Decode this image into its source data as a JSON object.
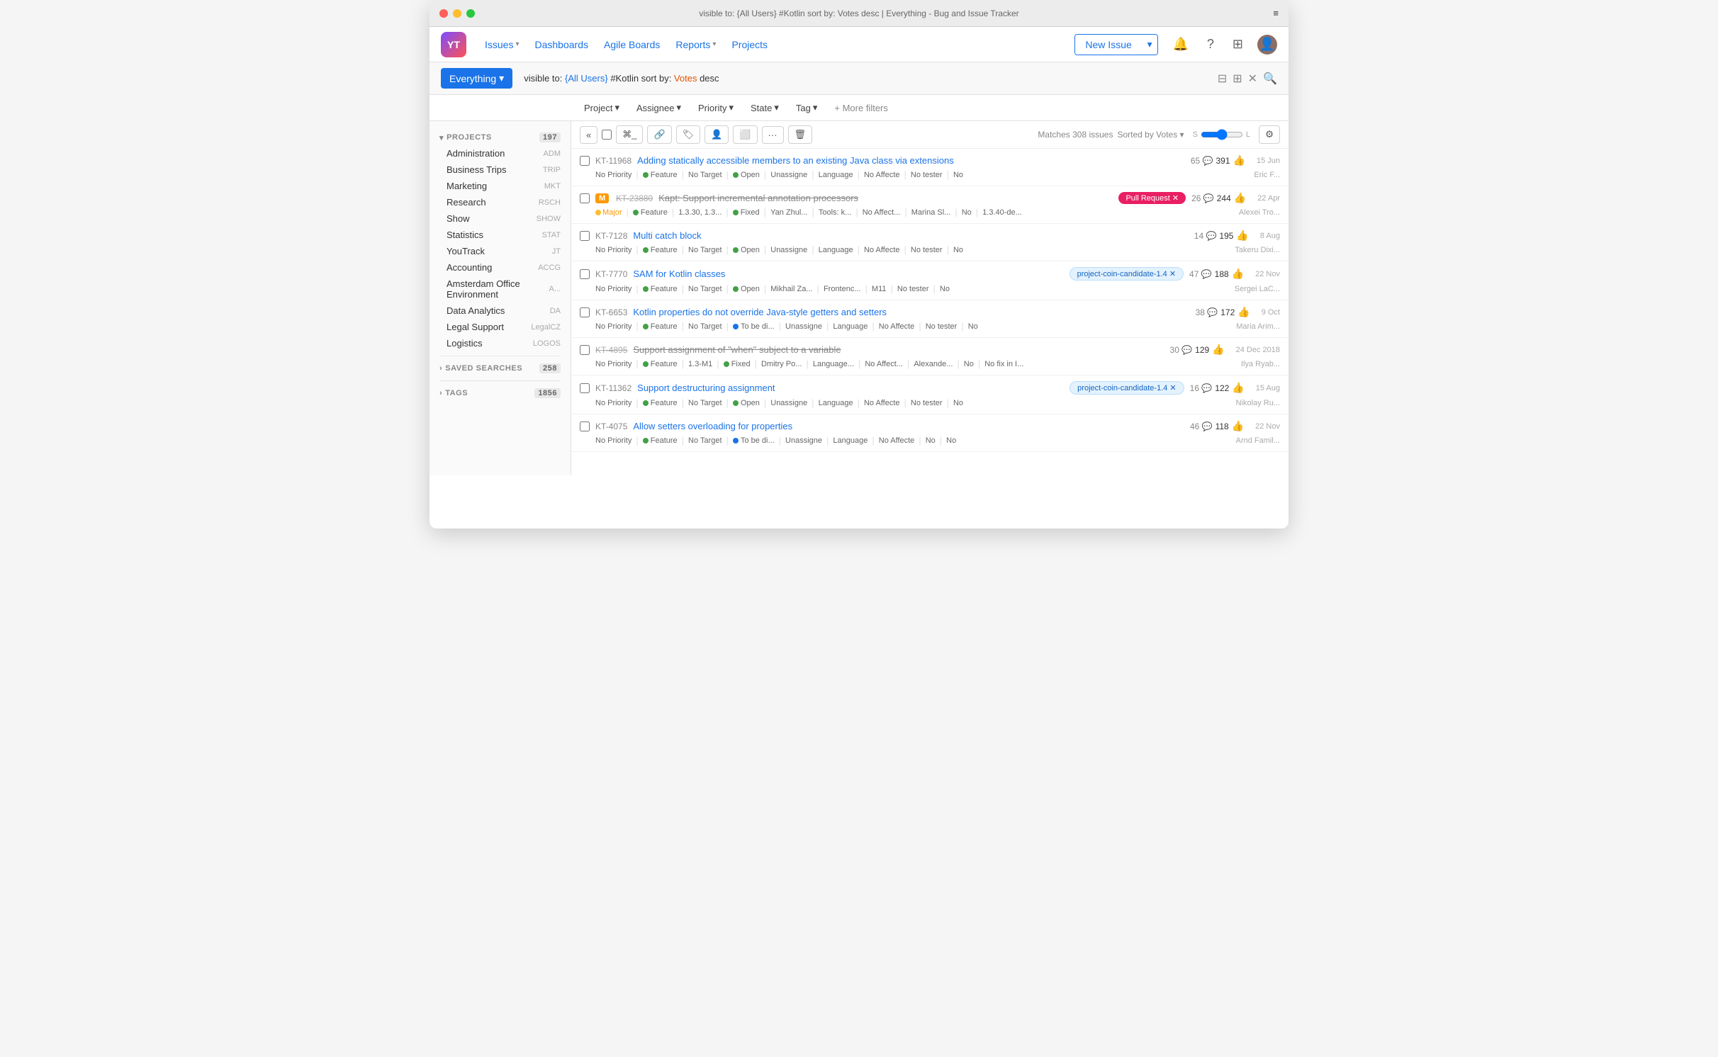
{
  "window": {
    "title": "visible to: {All Users} #Kotlin sort by: Votes desc | Everything - Bug and Issue Tracker",
    "traffic_lights": [
      "red",
      "yellow",
      "green"
    ]
  },
  "navbar": {
    "logo": "YT",
    "items": [
      {
        "label": "Issues",
        "has_arrow": true
      },
      {
        "label": "Dashboards",
        "has_arrow": false
      },
      {
        "label": "Agile Boards",
        "has_arrow": false
      },
      {
        "label": "Reports",
        "has_arrow": true
      },
      {
        "label": "Projects",
        "has_arrow": false
      }
    ],
    "new_issue": "New Issue",
    "new_issue_arrow": "▼"
  },
  "searchbar": {
    "everything_label": "Everything",
    "everything_arrow": "▾",
    "query_prefix": "visible to: ",
    "query_hl1": "{All Users}",
    "query_mid": " #Kotlin sort by: ",
    "query_hl2": "Votes",
    "query_suffix": " desc"
  },
  "filters": {
    "project": "Project",
    "assignee": "Assignee",
    "priority": "Priority",
    "state": "State",
    "tag": "Tag",
    "more": "+ More filters"
  },
  "sidebar": {
    "projects_label": "PROJECTS",
    "projects_count": "197",
    "projects": [
      {
        "name": "Administration",
        "tag": "ADM"
      },
      {
        "name": "Business Trips",
        "tag": "TRIP"
      },
      {
        "name": "Marketing",
        "tag": "MKT"
      },
      {
        "name": "Research",
        "tag": "RSCH"
      },
      {
        "name": "Show",
        "tag": "SHOW"
      },
      {
        "name": "Statistics",
        "tag": "STAT"
      },
      {
        "name": "YouTrack",
        "tag": "JT"
      },
      {
        "name": "Accounting",
        "tag": "ACCG"
      },
      {
        "name": "Amsterdam Office Environment",
        "tag": "A..."
      },
      {
        "name": "Data Analytics",
        "tag": "DA"
      },
      {
        "name": "Legal Support",
        "tag": "LegalCZ"
      },
      {
        "name": "Logistics",
        "tag": "LOGOS"
      }
    ],
    "saved_searches_label": "SAVED SEARCHES",
    "saved_searches_count": "258",
    "tags_label": "TAGS",
    "tags_count": "1856"
  },
  "issues_toolbar": {
    "match_info": "Matches 308 issues",
    "sorted_by": "Sorted by Votes",
    "size_s": "S",
    "size_l": "L",
    "toolbar_icons": [
      "⌘_",
      "🔗",
      "🏷",
      "👤",
      "⬜",
      "···",
      "🗑"
    ]
  },
  "issues": [
    {
      "id": "KT-11968",
      "strikethrough": false,
      "title": "Adding statically accessible members to an existing Java class via extensions",
      "badge": null,
      "comments": "65",
      "votes": "391",
      "priority": "No Priority",
      "type": "Feature",
      "target": "No Target",
      "state": "Open",
      "state_color": "green",
      "assignee": "Unassigne",
      "subsystem": "Language",
      "affected": "No Affecte",
      "tester": "No tester",
      "fix": "No",
      "author": "Eric F...",
      "date": "15 Jun"
    },
    {
      "id": "KT-23880",
      "strikethrough": true,
      "title": "Kapt: Support incremental annotation processors",
      "badge": "Pull Request ✕",
      "badge_type": "pull-request",
      "m_badge": "M",
      "comments": "26",
      "votes": "244",
      "priority": "Major",
      "priority_color": "yellow",
      "type": "Feature",
      "target": "1.3.30, 1.3...",
      "state": "Fixed",
      "state_color": "green",
      "assignee": "Yan Zhul...",
      "subsystem": "Tools: k...",
      "affected": "No Affect...",
      "tester": "Marina Sl...",
      "fix": "No",
      "version": "1.3.40-de...",
      "author": "Alexei Tro...",
      "date": "22 Apr"
    },
    {
      "id": "KT-7128",
      "strikethrough": false,
      "title": "Multi catch block",
      "badge": null,
      "comments": "14",
      "votes": "195",
      "priority": "No Priority",
      "type": "Feature",
      "target": "No Target",
      "state": "Open",
      "state_color": "green",
      "assignee": "Unassigne",
      "subsystem": "Language",
      "affected": "No Affecte",
      "tester": "No tester",
      "fix": "No",
      "author": "Takeru Dixi...",
      "date": "8 Aug"
    },
    {
      "id": "KT-7770",
      "strikethrough": false,
      "title": "SAM for Kotlin classes",
      "badge": "project-coin-candidate-1.4 ✕",
      "badge_type": "tag",
      "comments": "47",
      "votes": "188",
      "priority": "No Priority",
      "type": "Feature",
      "target": "No Target",
      "state": "Open",
      "state_color": "green",
      "assignee": "Mikhail Za...",
      "subsystem": "Frontenc...",
      "affected": "M11",
      "tester": "No tester",
      "fix": "No",
      "author": "Sergei LaC...",
      "date": "22 Nov"
    },
    {
      "id": "KT-6653",
      "strikethrough": false,
      "title": "Kotlin properties do not override Java-style getters and setters",
      "badge": null,
      "comments": "38",
      "votes": "172",
      "priority": "No Priority",
      "type": "Feature",
      "target": "No Target",
      "state": "To be di...",
      "state_color": "blue",
      "assignee": "Unassigne",
      "subsystem": "Language",
      "affected": "No Affecte",
      "tester": "No tester",
      "fix": "No",
      "author": "Maria Arim...",
      "date": "9 Oct"
    },
    {
      "id": "KT-4895",
      "strikethrough": true,
      "title": "Support assignment of \"when\" subject to a variable",
      "badge": null,
      "comments": "30",
      "votes": "129",
      "priority": "No Priority",
      "type": "Feature",
      "target": "1.3-M1",
      "state": "Fixed",
      "state_color": "green",
      "assignee": "Dmitry Po...",
      "subsystem": "Language...",
      "affected": "No Affect...",
      "tester": "Alexande...",
      "fix": "No",
      "version": "No fix in I...",
      "author": "Ilya Ryab...",
      "date": "24 Dec 2018"
    },
    {
      "id": "KT-11362",
      "strikethrough": false,
      "title": "Support destructuring assignment",
      "badge": "project-coin-candidate-1.4 ✕",
      "badge_type": "tag",
      "comments": "16",
      "votes": "122",
      "priority": "No Priority",
      "type": "Feature",
      "target": "No Target",
      "state": "Open",
      "state_color": "green",
      "assignee": "Unassigne",
      "subsystem": "Language",
      "affected": "No Affecte",
      "tester": "No tester",
      "fix": "No",
      "author": "Nikolay Ru...",
      "date": "15 Aug"
    },
    {
      "id": "KT-4075",
      "strikethrough": false,
      "title": "Allow setters overloading for properties",
      "badge": null,
      "comments": "46",
      "votes": "118",
      "priority": "No Priority",
      "type": "Feature",
      "target": "No Target",
      "state": "To be di...",
      "state_color": "blue",
      "assignee": "Unassigne",
      "subsystem": "Language",
      "affected": "No Affecte",
      "tester": "No",
      "fix": "No",
      "author": "Arnd Famil...",
      "date": "22 Nov"
    }
  ]
}
